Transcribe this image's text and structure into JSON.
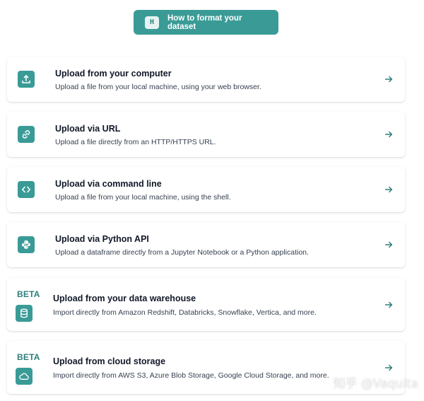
{
  "top_button": {
    "badge": "H",
    "label": "How to format your dataset"
  },
  "options": [
    {
      "title": "Upload from your computer",
      "description": "Upload a file from your local machine, using your web browser.",
      "icon": "upload-icon",
      "beta": ""
    },
    {
      "title": "Upload via URL",
      "description": "Upload a file directly from an HTTP/HTTPS URL.",
      "icon": "link-icon",
      "beta": ""
    },
    {
      "title": "Upload via command line",
      "description": "Upload a file from your local machine, using the shell.",
      "icon": "code-icon",
      "beta": ""
    },
    {
      "title": "Upload via Python API",
      "description": "Upload a dataframe directly from a Jupyter Notebook or a Python application.",
      "icon": "python-icon",
      "beta": ""
    },
    {
      "title": "Upload from your data warehouse",
      "description": "Import directly from Amazon Redshift, Databricks, Snowflake, Vertica, and more.",
      "icon": "database-icon",
      "beta": "BETA"
    },
    {
      "title": "Upload from cloud storage",
      "description": "Import directly from AWS S3, Azure Blob Storage, Google Cloud Storage, and more.",
      "icon": "cloud-icon",
      "beta": "BETA"
    }
  ],
  "watermark": "知乎 @Vaquita",
  "colors": {
    "accent": "#3a9b96",
    "accent_dark": "#2c7f7a",
    "text": "#111827",
    "muted": "#374151"
  }
}
